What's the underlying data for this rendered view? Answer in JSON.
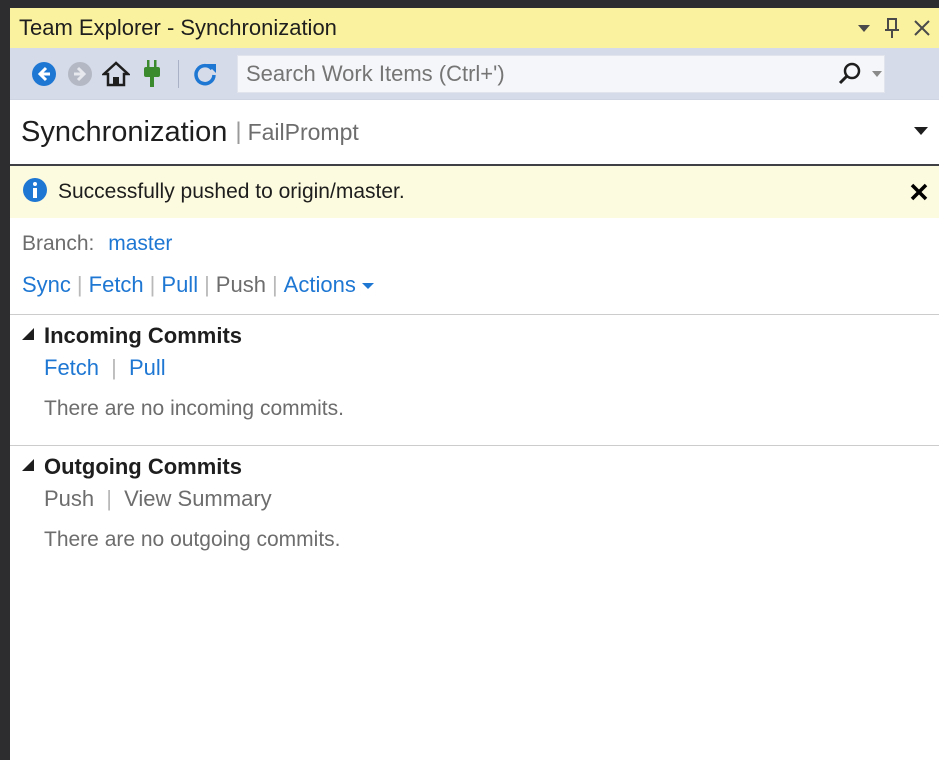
{
  "window": {
    "title": "Team Explorer - Synchronization"
  },
  "toolbar": {
    "search_placeholder": "Search Work Items (Ctrl+')"
  },
  "header": {
    "title": "Synchronization",
    "separator": "|",
    "repo": "FailPrompt"
  },
  "notification": {
    "message": "Successfully pushed to origin/master."
  },
  "branch": {
    "label": "Branch:",
    "name": "master"
  },
  "actions": {
    "sync": "Sync",
    "fetch": "Fetch",
    "pull": "Pull",
    "push": "Push",
    "actions": "Actions",
    "sep": "|"
  },
  "incoming": {
    "title": "Incoming Commits",
    "fetch": "Fetch",
    "pull": "Pull",
    "empty": "There are no incoming commits."
  },
  "outgoing": {
    "title": "Outgoing Commits",
    "push": "Push",
    "view_summary": "View Summary",
    "empty": "There are no outgoing commits."
  },
  "icons": {
    "back": "back-icon",
    "forward": "forward-icon",
    "home": "home-icon",
    "connect": "plug-icon",
    "refresh": "refresh-icon",
    "search": "search-icon",
    "info": "info-icon",
    "close": "close-icon"
  },
  "colors": {
    "title_bar": "#fbf29f",
    "toolbar": "#d6dbe9",
    "link": "#1e77d3",
    "info_bar": "#fdfbdf",
    "accent_blue": "#1e77d3"
  }
}
